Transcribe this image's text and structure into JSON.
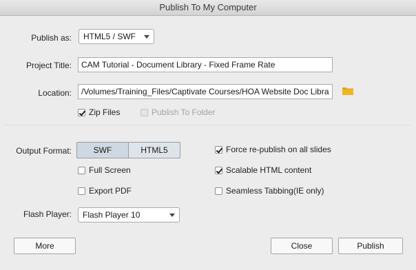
{
  "window": {
    "title": "Publish To My Computer"
  },
  "publish_as": {
    "label": "Publish as:",
    "value": "HTML5 / SWF"
  },
  "project_title": {
    "label": "Project Title:",
    "value": "CAM Tutorial - Document Library - Fixed Frame Rate"
  },
  "location": {
    "label": "Location:",
    "value": "/Volumes/Training_Files/Captivate Courses/HOA Website Doc Libra"
  },
  "zip_files": {
    "label": "Zip Files",
    "checked": true
  },
  "publish_to_folder": {
    "label": "Publish To Folder",
    "checked": false,
    "disabled": true
  },
  "output_format": {
    "label": "Output Format:",
    "options": [
      "SWF",
      "HTML5"
    ]
  },
  "full_screen": {
    "label": "Full Screen",
    "checked": false
  },
  "export_pdf": {
    "label": "Export PDF",
    "checked": false
  },
  "force_republish": {
    "label": "Force re-publish on all slides",
    "checked": true
  },
  "scalable_html": {
    "label": "Scalable HTML content",
    "checked": true
  },
  "seamless_tabbing": {
    "label": "Seamless Tabbing(IE only)",
    "checked": false
  },
  "flash_player": {
    "label": "Flash Player:",
    "value": "Flash Player 10"
  },
  "buttons": {
    "more": "More",
    "close": "Close",
    "publish": "Publish"
  },
  "colors": {
    "folder_icon": "#e3a81b",
    "segment_selected": "#cfd8e2",
    "window_bg": "#ececec"
  }
}
